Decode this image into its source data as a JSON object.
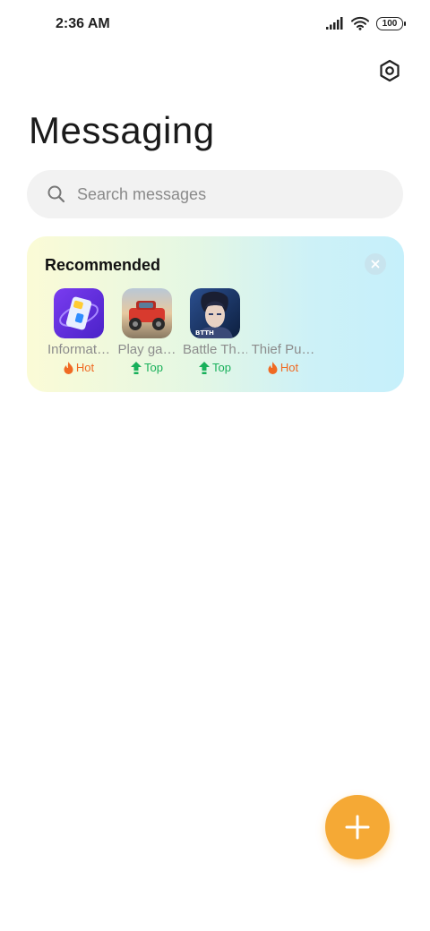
{
  "status_bar": {
    "time": "2:36 AM",
    "battery": "100"
  },
  "header": {
    "title": "Messaging",
    "settings_icon": "settings-hexagon-icon"
  },
  "search": {
    "placeholder": "Search messages"
  },
  "recommended": {
    "title": "Recommended",
    "apps": [
      {
        "name": "Informat…",
        "badge": "Hot",
        "badge_type": "hot"
      },
      {
        "name": "Play ga…",
        "badge": "Top",
        "badge_type": "top"
      },
      {
        "name": "Battle Th…",
        "badge": "Top",
        "badge_type": "top"
      },
      {
        "name": "Thief Pu…",
        "badge": "Hot",
        "badge_type": "hot"
      }
    ]
  },
  "colors": {
    "fab": "#f5a935",
    "hot": "#f06a23",
    "top": "#18b05a"
  }
}
